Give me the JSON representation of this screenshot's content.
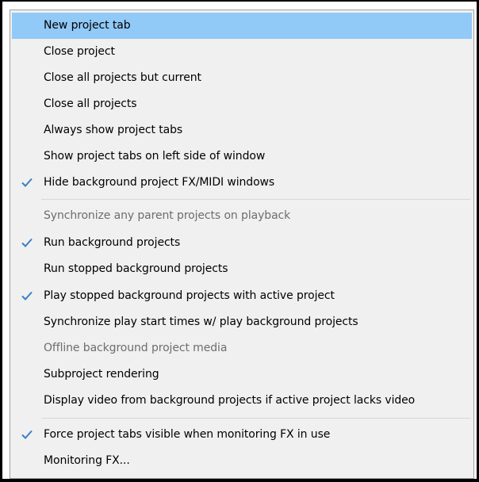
{
  "menu": {
    "items": [
      {
        "label": "New project tab",
        "checked": false,
        "disabled": false,
        "highlighted": true
      },
      {
        "label": "Close project",
        "checked": false,
        "disabled": false,
        "highlighted": false
      },
      {
        "label": "Close all projects but current",
        "checked": false,
        "disabled": false,
        "highlighted": false
      },
      {
        "label": "Close all projects",
        "checked": false,
        "disabled": false,
        "highlighted": false
      },
      {
        "label": "Always show project tabs",
        "checked": false,
        "disabled": false,
        "highlighted": false
      },
      {
        "label": "Show project tabs on left side of window",
        "checked": false,
        "disabled": false,
        "highlighted": false
      },
      {
        "label": "Hide background project FX/MIDI windows",
        "checked": true,
        "disabled": false,
        "highlighted": false
      },
      {
        "label": "Synchronize any parent projects on playback",
        "checked": false,
        "disabled": true,
        "highlighted": false
      },
      {
        "label": "Run background projects",
        "checked": true,
        "disabled": false,
        "highlighted": false
      },
      {
        "label": "Run stopped background projects",
        "checked": false,
        "disabled": false,
        "highlighted": false
      },
      {
        "label": "Play stopped background projects with active project",
        "checked": true,
        "disabled": false,
        "highlighted": false
      },
      {
        "label": "Synchronize play start times w/ play background projects",
        "checked": false,
        "disabled": false,
        "highlighted": false
      },
      {
        "label": "Offline background project media",
        "checked": false,
        "disabled": true,
        "highlighted": false
      },
      {
        "label": "Subproject rendering",
        "checked": false,
        "disabled": false,
        "highlighted": false
      },
      {
        "label": "Display video from background projects if active project lacks video",
        "checked": false,
        "disabled": false,
        "highlighted": false
      },
      {
        "label": "Force project tabs visible when monitoring FX in use",
        "checked": true,
        "disabled": false,
        "highlighted": false
      },
      {
        "label": "Monitoring FX...",
        "checked": false,
        "disabled": false,
        "highlighted": false
      }
    ]
  },
  "colors": {
    "highlight": "#91c9f7",
    "check": "#3b7fc4",
    "disabled_text": "#6d6d6d"
  },
  "icons": {
    "check": "checkmark-icon"
  }
}
